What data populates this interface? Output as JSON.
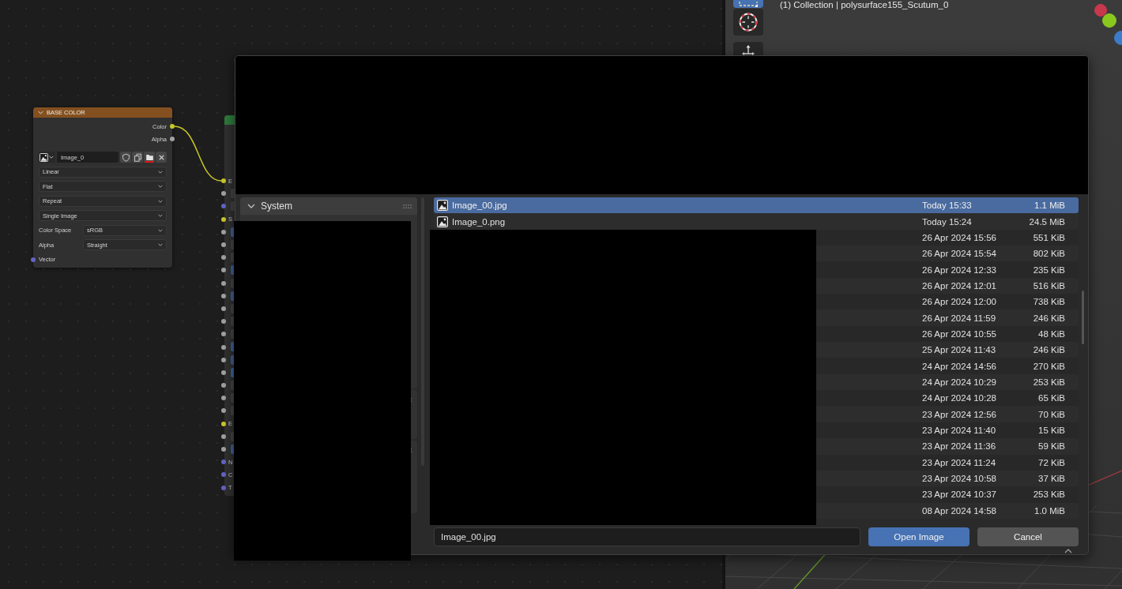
{
  "node_editor": {
    "image_node": {
      "title": "BASE COLOR",
      "outputs": [
        {
          "label": "Color",
          "color": "#c7c729"
        },
        {
          "label": "Alpha",
          "color": "#a1a1a1"
        }
      ],
      "image": {
        "name": "Image_0",
        "buttons": [
          {
            "kind": "fake_user",
            "highlighted": false
          },
          {
            "kind": "duplicate",
            "highlighted": false
          },
          {
            "kind": "open",
            "highlighted": true
          },
          {
            "kind": "unlink",
            "highlighted": false
          }
        ]
      },
      "settings": [
        {
          "value": "Linear"
        },
        {
          "value": "Flat"
        },
        {
          "value": "Repeat"
        },
        {
          "value": "Single Image"
        },
        {
          "label": "Color Space",
          "value": "sRGB"
        },
        {
          "label": "Alpha",
          "value": "Straight"
        }
      ],
      "inputs": [
        {
          "label": "Vector",
          "color": "#6363c7"
        }
      ]
    },
    "shader_node": {
      "sockets": [
        {
          "color": "#c7c729",
          "kind": "label",
          "label": "E"
        },
        {
          "color": "#a1a1a1",
          "kind": "value"
        },
        {
          "color": "#6363c7",
          "kind": "value"
        },
        {
          "color": "#c7c729",
          "kind": "label",
          "label": "S"
        },
        {
          "color": "#a1a1a1",
          "kind": "slider"
        },
        {
          "color": "#a1a1a1",
          "kind": "value"
        },
        {
          "color": "#a1a1a1",
          "kind": "value"
        },
        {
          "color": "#a1a1a1",
          "kind": "slider"
        },
        {
          "color": "#a1a1a1",
          "kind": "value"
        },
        {
          "color": "#a1a1a1",
          "kind": "slider"
        },
        {
          "color": "#a1a1a1",
          "kind": "value"
        },
        {
          "color": "#a1a1a1",
          "kind": "value"
        },
        {
          "color": "#a1a1a1",
          "kind": "value"
        },
        {
          "color": "#a1a1a1",
          "kind": "slider"
        },
        {
          "color": "#a1a1a1",
          "kind": "slider"
        },
        {
          "color": "#a1a1a1",
          "kind": "slider"
        },
        {
          "color": "#a1a1a1",
          "kind": "value"
        },
        {
          "color": "#a1a1a1",
          "kind": "value"
        },
        {
          "color": "#a1a1a1",
          "kind": "value"
        },
        {
          "color": "#c7c729",
          "kind": "label",
          "label": "E"
        },
        {
          "color": "#a1a1a1",
          "kind": "value"
        },
        {
          "color": "#a1a1a1",
          "kind": "slider"
        },
        {
          "color": "#6363c7",
          "kind": "label",
          "label": "N"
        },
        {
          "color": "#6363c7",
          "kind": "label",
          "label": "C"
        },
        {
          "color": "#6363c7",
          "kind": "label",
          "label": "T"
        }
      ]
    }
  },
  "viewport": {
    "info": "(1) Collection | polysurface155_Scutum_0",
    "tools": [
      {
        "kind": "select_box",
        "selected": true
      },
      {
        "kind": "cursor",
        "selected": false
      },
      {
        "kind": "move",
        "selected": false
      }
    ],
    "gizmo": [
      {
        "color": "#c8384c"
      },
      {
        "color": "#8bc81f"
      },
      {
        "color": "#3d7cc9"
      }
    ]
  },
  "file_dialog": {
    "sidebar_panels": [
      {
        "title": "System"
      }
    ],
    "files": [
      {
        "name": "Image_00.jpg",
        "date": "Today 15:33",
        "size": "1.1 MiB",
        "selected": true
      },
      {
        "name": "Image_0.png",
        "date": "Today 15:24",
        "size": "24.5 MiB",
        "selected": false
      },
      {
        "date": "26 Apr 2024 15:56",
        "size": "551 KiB",
        "selected": false
      },
      {
        "date": "26 Apr 2024 15:54",
        "size": "802 KiB",
        "selected": false
      },
      {
        "date": "26 Apr 2024 12:33",
        "size": "235 KiB",
        "selected": false
      },
      {
        "date": "26 Apr 2024 12:01",
        "size": "516 KiB",
        "selected": false
      },
      {
        "date": "26 Apr 2024 12:00",
        "size": "738 KiB",
        "selected": false
      },
      {
        "date": "26 Apr 2024 11:59",
        "size": "246 KiB",
        "selected": false
      },
      {
        "date": "26 Apr 2024 10:55",
        "size": "48 KiB",
        "selected": false
      },
      {
        "date": "25 Apr 2024 11:43",
        "size": "246 KiB",
        "selected": false
      },
      {
        "date": "24 Apr 2024 14:56",
        "size": "270 KiB",
        "selected": false
      },
      {
        "date": "24 Apr 2024 10:29",
        "size": "253 KiB",
        "selected": false
      },
      {
        "date": "24 Apr 2024 10:28",
        "size": "65 KiB",
        "selected": false
      },
      {
        "date": "23 Apr 2024 12:56",
        "size": "70 KiB",
        "selected": false
      },
      {
        "date": "23 Apr 2024 11:40",
        "size": "15 KiB",
        "selected": false
      },
      {
        "date": "23 Apr 2024 11:36",
        "size": "59 KiB",
        "selected": false
      },
      {
        "date": "23 Apr 2024 11:24",
        "size": "72 KiB",
        "selected": false
      },
      {
        "date": "23 Apr 2024 10:58",
        "size": "37 KiB",
        "selected": false
      },
      {
        "date": "23 Apr 2024 10:37",
        "size": "253 KiB",
        "selected": false
      },
      {
        "date": "08 Apr 2024 14:58",
        "size": "1.0 MiB",
        "selected": false
      }
    ],
    "filename": "Image_00.jpg",
    "buttons": [
      {
        "label": "Open Image",
        "kind": "primary"
      },
      {
        "label": "Cancel",
        "kind": "secondary"
      }
    ]
  }
}
